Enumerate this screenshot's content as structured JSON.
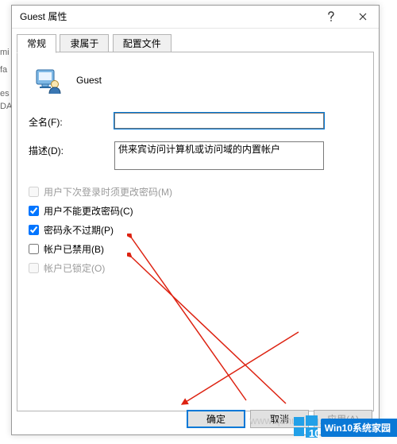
{
  "titlebar": {
    "title": "Guest 属性"
  },
  "tabs": [
    {
      "label": "常规",
      "active": true
    },
    {
      "label": "隶属于",
      "active": false
    },
    {
      "label": "配置文件",
      "active": false
    }
  ],
  "header": {
    "user_name": "Guest"
  },
  "form": {
    "fullname_label": "全名(F):",
    "fullname_value": "",
    "desc_label": "描述(D):",
    "desc_value": "供来宾访问计算机或访问域的内置帐户"
  },
  "checks": [
    {
      "label": "用户下次登录时须更改密码(M)",
      "checked": false,
      "enabled": false
    },
    {
      "label": "用户不能更改密码(C)",
      "checked": true,
      "enabled": true
    },
    {
      "label": "密码永不过期(P)",
      "checked": true,
      "enabled": true
    },
    {
      "label": "帐户已禁用(B)",
      "checked": false,
      "enabled": true
    },
    {
      "label": "帐户已锁定(O)",
      "checked": false,
      "enabled": false
    }
  ],
  "buttons": {
    "ok": "确定",
    "cancel": "取消",
    "apply": "应用(A)"
  },
  "watermark": "www.qdhuajing.com",
  "badge": {
    "text": "Win10系统家园"
  },
  "bg_fragments": [
    "mi",
    "fa",
    "es",
    "DA"
  ]
}
